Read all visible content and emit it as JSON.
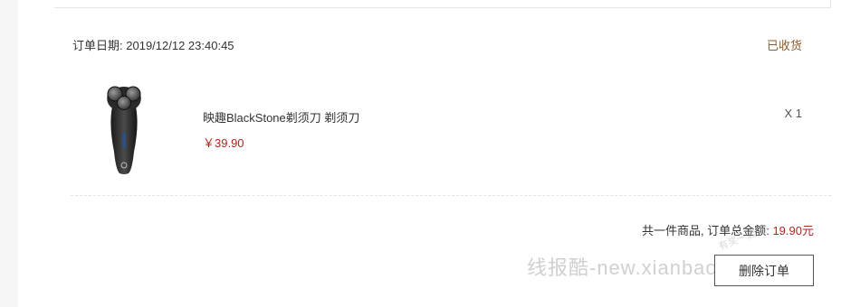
{
  "order": {
    "date_label": "订单日期:",
    "date_value": "2019/12/12 23:40:45",
    "status": "已收货"
  },
  "item": {
    "name": "映趣BlackStone剃须刀 剃须刀",
    "price": "￥39.90",
    "quantity": "X 1"
  },
  "summary": {
    "text": "共一件商品, 订单总金额:",
    "total": "19.90元"
  },
  "actions": {
    "delete_label": "删除订单"
  },
  "watermark": {
    "text": "线报酷-new.xianbao.fun",
    "stamp": "有奖一起赚"
  },
  "colors": {
    "price": "#b0281f",
    "status": "#8a5a2b",
    "background": "#f5f5f5",
    "card": "#ffffff"
  }
}
